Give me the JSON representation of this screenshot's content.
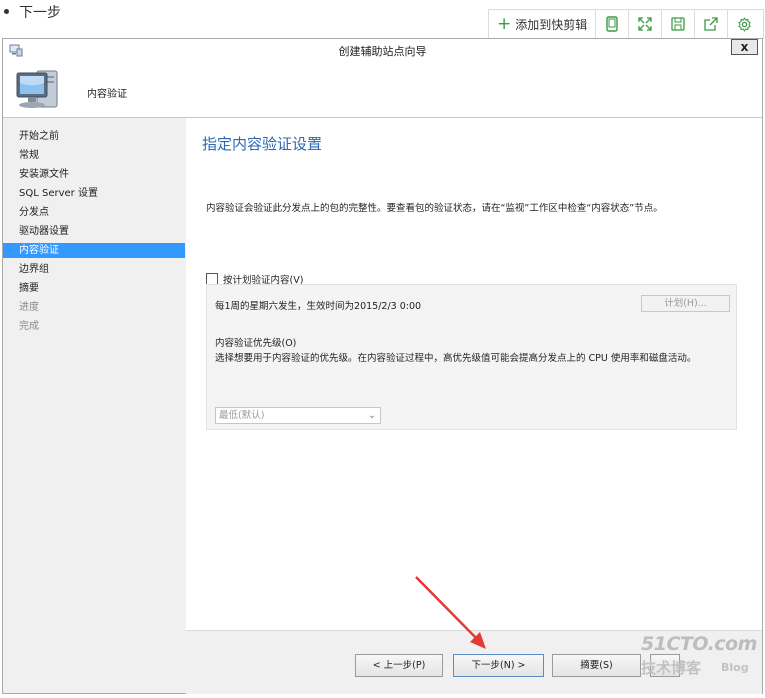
{
  "bullet": {
    "text": "下一步"
  },
  "toolbar": {
    "add_label": "添加到快剪辑",
    "icons": [
      "mobile-icon",
      "expand-icon",
      "save-icon",
      "share-icon",
      "settings-icon"
    ]
  },
  "window": {
    "title": "创建辅助站点向导",
    "close": "x",
    "header_label": "内容验证"
  },
  "nav": {
    "items": [
      {
        "label": "开始之前",
        "state": "normal"
      },
      {
        "label": "常规",
        "state": "normal"
      },
      {
        "label": "安装源文件",
        "state": "normal"
      },
      {
        "label": "SQL Server 设置",
        "state": "normal"
      },
      {
        "label": "分发点",
        "state": "normal"
      },
      {
        "label": "驱动器设置",
        "state": "normal"
      },
      {
        "label": "内容验证",
        "state": "selected"
      },
      {
        "label": "边界组",
        "state": "normal"
      },
      {
        "label": "摘要",
        "state": "normal"
      },
      {
        "label": "进度",
        "state": "disabled"
      },
      {
        "label": "完成",
        "state": "disabled"
      }
    ]
  },
  "page": {
    "heading": "指定内容验证设置",
    "description": "内容验证会验证此分发点上的包的完整性。要查看包的验证状态，请在“监视”工作区中检查“内容状态”节点。",
    "schedule_checkbox": "按计划验证内容(V)",
    "schedule_checked": false,
    "schedule_text": "每1周的星期六发生，生效时间为2015/2/3 0:00",
    "schedule_button": "计划(H)...",
    "priority_label": "内容验证优先级(O)",
    "priority_desc": "选择想要用于内容验证的优先级。在内容验证过程中，高优先级值可能会提高分发点上的 CPU 使用率和磁盘活动。",
    "priority_value": "最低(默认)"
  },
  "buttons": {
    "prev": "< 上一步(P)",
    "next": "下一步(N) >",
    "summary": "摘要(S)"
  },
  "watermark": {
    "line1": "51CTO.com",
    "line2": "技术博客",
    "line3": "Blog"
  },
  "colors": {
    "selection": "#3399ff",
    "heading": "#2a68b0",
    "arrow": "#e53935",
    "toolbar_accent": "#3a9a45"
  }
}
